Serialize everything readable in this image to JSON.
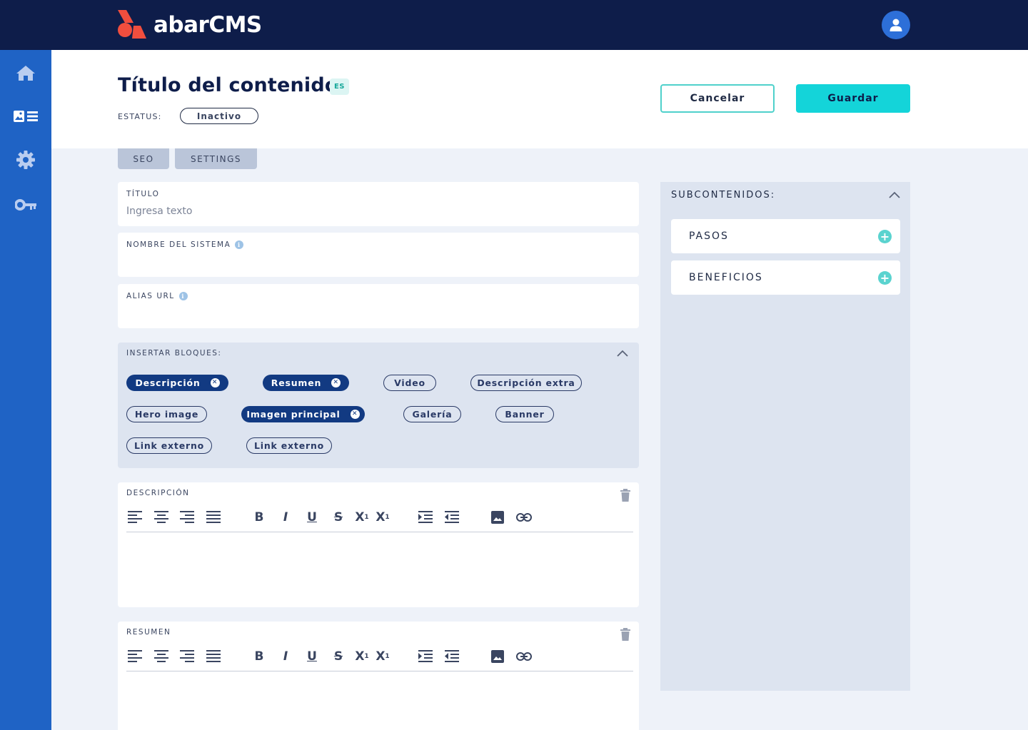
{
  "brand": {
    "name": "abarCMS"
  },
  "colors": {
    "topbar": "#0e1d4a",
    "sidebar": "#1f63c5",
    "accent": "#14d4d9",
    "chip_active": "#123a82"
  },
  "sidebar": {
    "items": [
      {
        "icon": "home-icon"
      },
      {
        "icon": "content-icon",
        "active": true
      },
      {
        "icon": "gear-icon"
      },
      {
        "icon": "key-icon"
      }
    ]
  },
  "header": {
    "title": "Título del contenido",
    "lang": "ES",
    "status_label": "ESTATUS:",
    "status_value": "Inactivo",
    "cancel_label": "Cancelar",
    "save_label": "Guardar"
  },
  "tabs": [
    {
      "label": "SEO"
    },
    {
      "label": "SETTINGS"
    }
  ],
  "fields": {
    "titulo": {
      "label": "TÍTULO",
      "value": "",
      "placeholder": "Ingresa texto"
    },
    "nombre": {
      "label": "NOMBRE DEL SISTEMA",
      "value": ""
    },
    "alias": {
      "label": "ALIAS URL",
      "value": ""
    }
  },
  "blocks": {
    "label": "INSERTAR BLOQUES:",
    "chips": [
      {
        "label": "Descripción",
        "active": true
      },
      {
        "label": "Resumen",
        "active": true
      },
      {
        "label": "Video",
        "active": false
      },
      {
        "label": "Descripción extra",
        "active": false
      },
      {
        "label": "Hero image",
        "active": false
      },
      {
        "label": "Imagen principal",
        "active": true
      },
      {
        "label": "Galería",
        "active": false
      },
      {
        "label": "Banner",
        "active": false
      },
      {
        "label": "Link externo",
        "active": false
      },
      {
        "label": "Link externo",
        "active": false
      }
    ]
  },
  "editors": [
    {
      "label": "DESCRIPCIÓN"
    },
    {
      "label": "RESUMEN"
    }
  ],
  "toolbar": {
    "bold": "B",
    "italic": "I",
    "underline": "U",
    "strike": "S",
    "sup": "X",
    "sup_mark": "1",
    "sub": "X",
    "sub_mark": "1"
  },
  "subcontents": {
    "label": "SUBCONTENIDOS:",
    "items": [
      {
        "label": "PASOS"
      },
      {
        "label": "BENEFICIOS"
      }
    ]
  }
}
